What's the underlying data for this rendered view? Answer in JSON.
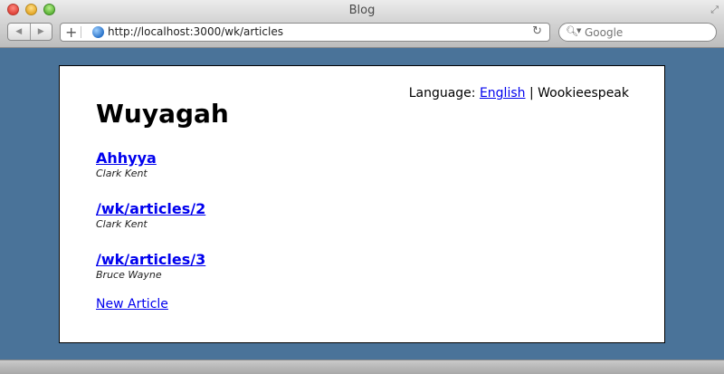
{
  "window": {
    "title": "Blog"
  },
  "toolbar": {
    "url": "http://localhost:3000/wk/articles",
    "search_placeholder": "Google",
    "icons": [
      "back-icon",
      "forward-icon",
      "add-tab-icon",
      "globe-icon",
      "reload-icon",
      "search-icon"
    ]
  },
  "page": {
    "language_label": "Language:",
    "language_separator": "|",
    "languages": [
      {
        "label": "English",
        "active": false
      },
      {
        "label": "Wookieespeak",
        "active": true
      }
    ],
    "title": "Wuyagah",
    "articles": [
      {
        "title": "Ahhyya",
        "author": "Clark Kent"
      },
      {
        "title": "/wk/articles/2",
        "author": "Clark Kent"
      },
      {
        "title": "/wk/articles/3",
        "author": "Bruce Wayne"
      }
    ],
    "new_article_label": "New Article"
  },
  "colors": {
    "background": "#4a7399",
    "link": "#0000ee"
  }
}
